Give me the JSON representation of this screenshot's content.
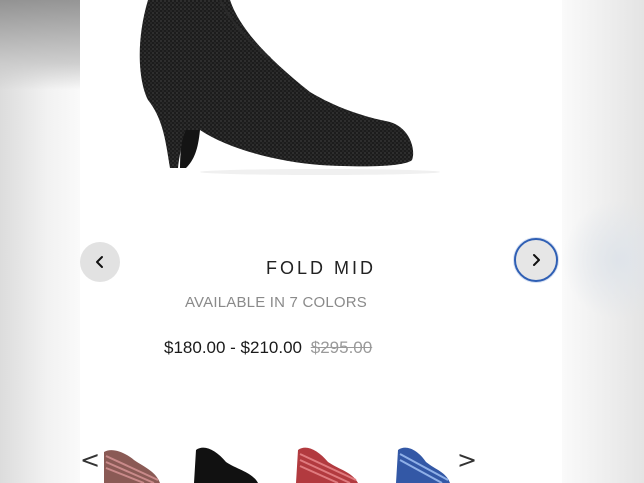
{
  "product": {
    "name": "FOLD MID",
    "availability": "AVAILABLE IN 7 COLORS",
    "price_range": "$180.00 - $210.00",
    "original_price": "$295.00"
  },
  "carousel": {
    "prev_icon": "chevron-left-icon",
    "next_icon": "chevron-right-icon"
  },
  "thumbnails": {
    "prev_label": "<",
    "next_label": ">",
    "items": [
      {
        "color": "#8a5a55",
        "name": "multicolor-pink-stripe"
      },
      {
        "color": "#111111",
        "name": "black"
      },
      {
        "color": "#b23a3f",
        "name": "red-stripe"
      },
      {
        "color": "#3358a6",
        "name": "blue-stripe"
      }
    ]
  },
  "colors": {
    "accent_focus": "#2f5fb4",
    "price_strike": "#9a9a9a"
  }
}
